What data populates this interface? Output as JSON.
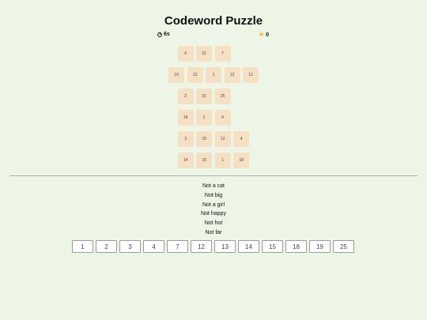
{
  "title": "Codeword Puzzle",
  "timer": {
    "value": "6s",
    "icon": "timer-icon"
  },
  "score": {
    "value": "0",
    "icon": "star-icon"
  },
  "grid": [
    [
      "4",
      "15",
      "7"
    ],
    [
      "19",
      "13",
      "1",
      "12",
      "12"
    ],
    [
      "2",
      "15",
      "25"
    ],
    [
      "19",
      "1",
      "4"
    ],
    [
      "3",
      "15",
      "12",
      "4"
    ],
    [
      "14",
      "15",
      "1",
      "18"
    ]
  ],
  "clues": [
    "Not a cat",
    "Not big",
    "Not a girl",
    "Not happy",
    "Not hot",
    "Not far"
  ],
  "keypad": [
    "1",
    "2",
    "3",
    "4",
    "7",
    "12",
    "13",
    "14",
    "15",
    "18",
    "19",
    "25"
  ],
  "colors": {
    "background": "#edf6e6",
    "cell": "#f6e0c3",
    "star": "#f1c232",
    "key_background": "#ffffff",
    "key_border": "#9a9a9a"
  }
}
